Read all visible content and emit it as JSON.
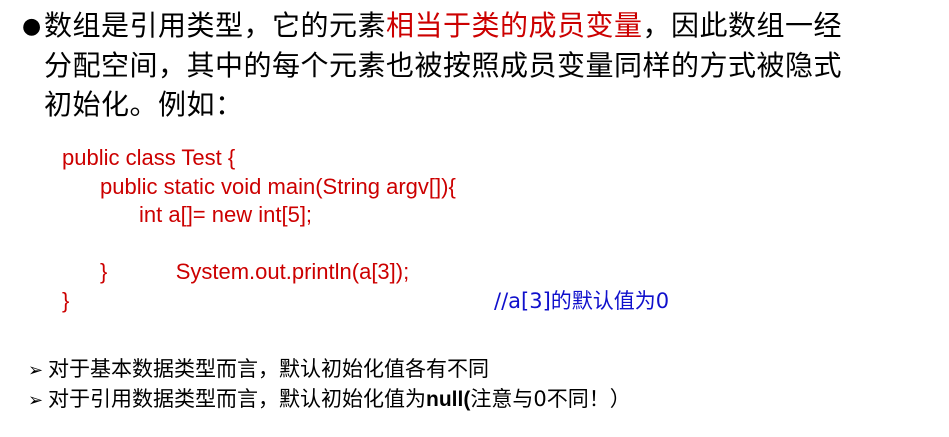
{
  "intro": {
    "bullet": "●",
    "line1_a": "数组是引用类型，它的元素",
    "line1_red": "相当于类的成员变量",
    "line1_b": "，因此数组一经",
    "line2": "分配空间，其中的每个元素也被按照成员变量同样的方式被隐式",
    "line3": "初始化。例如："
  },
  "code": {
    "line1": "public class Test {",
    "line2": "public static void main(String argv[]){",
    "line3": "int a[]= new int[5];",
    "line4": "System.out.println(a[3]);",
    "line4_comment": "//a[3]的默认值为0",
    "line5": "}",
    "line6": "}"
  },
  "notes": {
    "arrow": "➢",
    "note1": "对于基本数据类型而言，默认初始化值各有不同",
    "note2_a": "对于引用数据类型而言，默认初始化值为",
    "note2_bold": "null(",
    "note2_b": "注意与0不同！）"
  },
  "colors": {
    "highlight": "#cc0000",
    "comment": "#1010cc"
  }
}
